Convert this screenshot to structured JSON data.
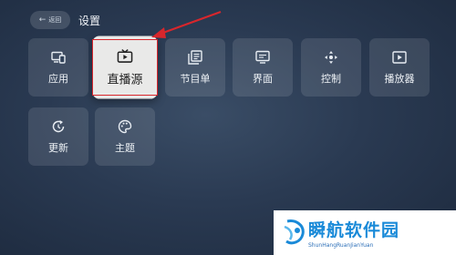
{
  "header": {
    "back_label": "返回",
    "title": "设置"
  },
  "tiles": [
    {
      "label": "应用",
      "icon": "app-icon"
    },
    {
      "label": "直播源",
      "icon": "tv-icon",
      "focused": true
    },
    {
      "label": "节目单",
      "icon": "program-list-icon"
    },
    {
      "label": "界面",
      "icon": "interface-icon"
    },
    {
      "label": "控制",
      "icon": "control-icon"
    },
    {
      "label": "播放器",
      "icon": "player-icon"
    },
    {
      "label": "更新",
      "icon": "update-icon"
    },
    {
      "label": "主题",
      "icon": "palette-icon"
    }
  ],
  "annotation": {
    "arrow_color": "#d8262c",
    "box_color": "#d8262c"
  },
  "watermark": {
    "name": "瞬航软件园",
    "pinyin": "ShunHangRuanJianYuan"
  }
}
